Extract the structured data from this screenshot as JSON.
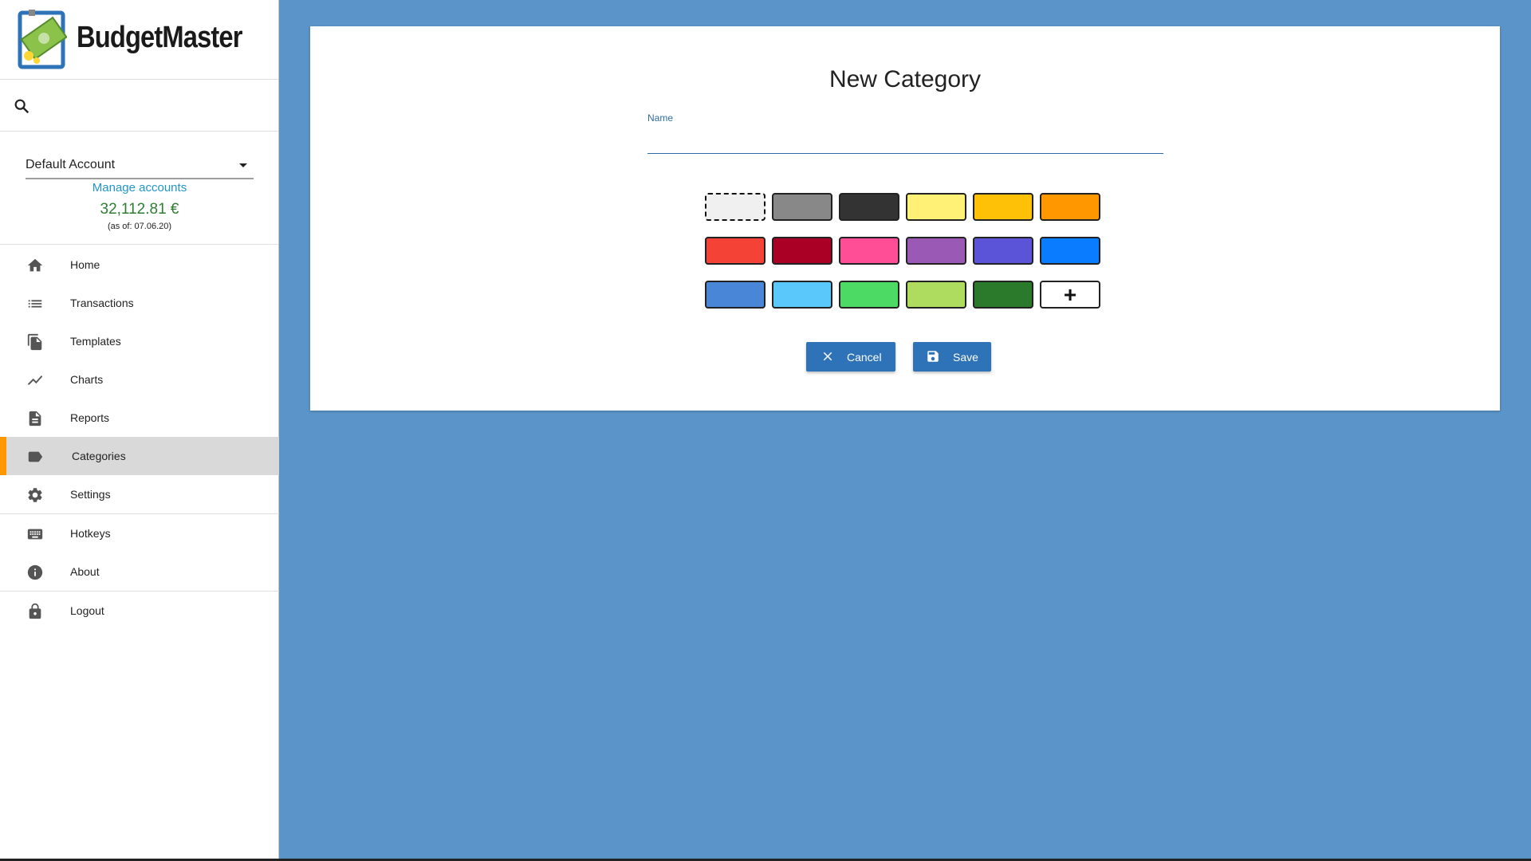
{
  "app": {
    "name": "BudgetMaster"
  },
  "account": {
    "selected": "Default Account",
    "manage_label": "Manage accounts",
    "balance": "32,112.81 €",
    "as_of": "(as of: 07.06.20)"
  },
  "nav": {
    "items": [
      {
        "label": "Home",
        "icon": "home-icon"
      },
      {
        "label": "Transactions",
        "icon": "list-icon"
      },
      {
        "label": "Templates",
        "icon": "file-copy-icon"
      },
      {
        "label": "Charts",
        "icon": "line-chart-icon"
      },
      {
        "label": "Reports",
        "icon": "document-icon"
      },
      {
        "label": "Categories",
        "icon": "label-icon",
        "active": true
      },
      {
        "label": "Settings",
        "icon": "gear-icon"
      },
      {
        "label": "Hotkeys",
        "icon": "keyboard-icon"
      },
      {
        "label": "About",
        "icon": "info-icon"
      },
      {
        "label": "Logout",
        "icon": "lock-icon"
      }
    ]
  },
  "form": {
    "title": "New Category",
    "name_label": "Name",
    "name_value": "",
    "colors": [
      [
        "#eeeeee",
        "#888888",
        "#333333",
        "#fff176",
        "#ffc107",
        "#ff9800"
      ],
      [
        "#f44336",
        "#aa0026",
        "#ff4d96",
        "#9b59b6",
        "#5b54d8",
        "#0a7cff"
      ],
      [
        "#4a86d8",
        "#5ac8fa",
        "#4cd964",
        "#addc5f",
        "#2b7a2b",
        "#ffffff"
      ]
    ],
    "add_symbol": "+",
    "cancel_label": "Cancel",
    "save_label": "Save"
  },
  "colors": {
    "background": "#5a94c8",
    "accent": "#ff9800",
    "primary_button": "#2e72b8",
    "link": "#2196c9",
    "balance": "#2e7d32"
  }
}
